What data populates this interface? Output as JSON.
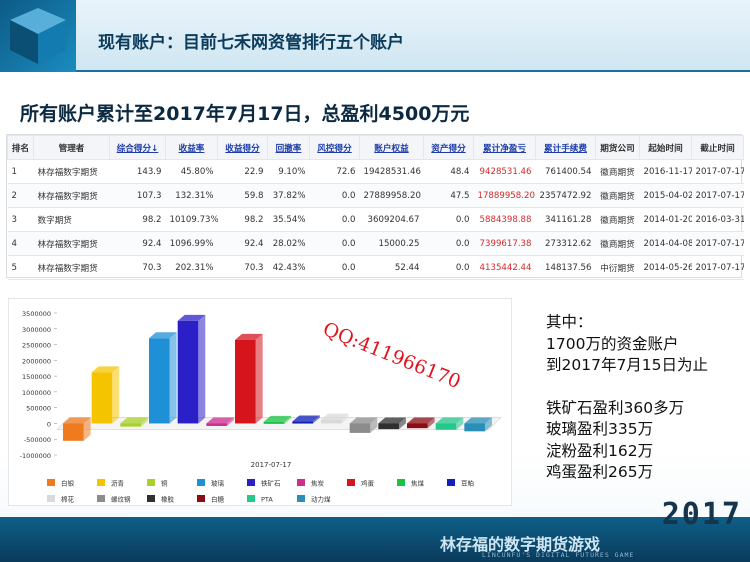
{
  "slide": {
    "title": "现有账户：目前七禾网资管排行五个账户",
    "subtitle": "所有账户累计至2017年7月17日，总盈利4500万元"
  },
  "table": {
    "headers": [
      "排名",
      "管理者",
      "综合得分↓",
      "收益率",
      "收益得分",
      "回撤率",
      "风控得分",
      "账户权益",
      "资产得分",
      "累计净盈亏",
      "累计手续费",
      "期货公司",
      "起始时间",
      "截止时间"
    ],
    "rows": [
      [
        "1",
        "林存福数字期货",
        "143.9",
        "45.80%",
        "22.9",
        "9.10%",
        "72.6",
        "19428531.46",
        "48.4",
        "9428531.46",
        "761400.54",
        "徽商期货",
        "2016-11-17",
        "2017-07-17"
      ],
      [
        "2",
        "林存福数字期货",
        "107.3",
        "132.31%",
        "59.8",
        "37.82%",
        "0.0",
        "27889958.20",
        "47.5",
        "17889958.20",
        "2357472.92",
        "徽商期货",
        "2015-04-02",
        "2017-07-17"
      ],
      [
        "3",
        "数字期货",
        "98.2",
        "10109.73%",
        "98.2",
        "35.54%",
        "0.0",
        "3609204.67",
        "0.0",
        "5884398.88",
        "341161.28",
        "徽商期货",
        "2014-01-20",
        "2016-03-31"
      ],
      [
        "4",
        "林存福数字期货",
        "92.4",
        "1096.99%",
        "92.4",
        "28.02%",
        "0.0",
        "15000.25",
        "0.0",
        "7399617.38",
        "273312.62",
        "徽商期货",
        "2014-04-08",
        "2017-07-17"
      ],
      [
        "5",
        "林存福数字期货",
        "70.3",
        "202.31%",
        "70.3",
        "42.43%",
        "0.0",
        "52.44",
        "0.0",
        "4135442.44",
        "148137.56",
        "中衍期货",
        "2014-05-26",
        "2017-07-17"
      ]
    ]
  },
  "chart_data": {
    "type": "bar",
    "title": "",
    "xlabel": "2017-07-17",
    "ylabel": "",
    "ylim": [
      -1000000,
      3500000
    ],
    "yticks": [
      "3500000",
      "3000000",
      "2500000",
      "2000000",
      "1500000",
      "1000000",
      "500000",
      "0",
      "-500000",
      "-1000000"
    ],
    "categories": [
      "白银",
      "沥青",
      "铜",
      "玻璃",
      "铁矿石",
      "焦炭",
      "鸡蛋",
      "焦煤",
      "豆粕",
      "棉花",
      "螺纹钢",
      "橡胶",
      "白糖",
      "PTA",
      "动力煤"
    ],
    "values": [
      -550000,
      1620000,
      -100000,
      2700000,
      3250000,
      -80000,
      2650000,
      50000,
      60000,
      120000,
      -300000,
      -180000,
      -150000,
      -200000,
      -250000
    ],
    "colors": [
      "#f07a1e",
      "#f5c400",
      "#a8d22a",
      "#1f8fd6",
      "#2b20c7",
      "#cc2d8f",
      "#d6141c",
      "#19c244",
      "#1020b8",
      "#d9d9d9",
      "#8c8c8c",
      "#2f2f2f",
      "#8b0d16",
      "#25c78b",
      "#2a8fb8"
    ],
    "grid": false,
    "legend_position": "bottom"
  },
  "watermark": "QQ:411966170",
  "notes": [
    "其中：",
    "1700万的资金账户",
    "到2017年7月15日为止",
    "",
    "铁矿石盈利360多万",
    "玻璃盈利335万",
    "淀粉盈利162万",
    "鸡蛋盈利265万"
  ],
  "brand": {
    "year": "2017",
    "cn": "林存福的数字期货游戏",
    "en": "LINCUNFU'S DIGITAL FUTURES GAME"
  }
}
